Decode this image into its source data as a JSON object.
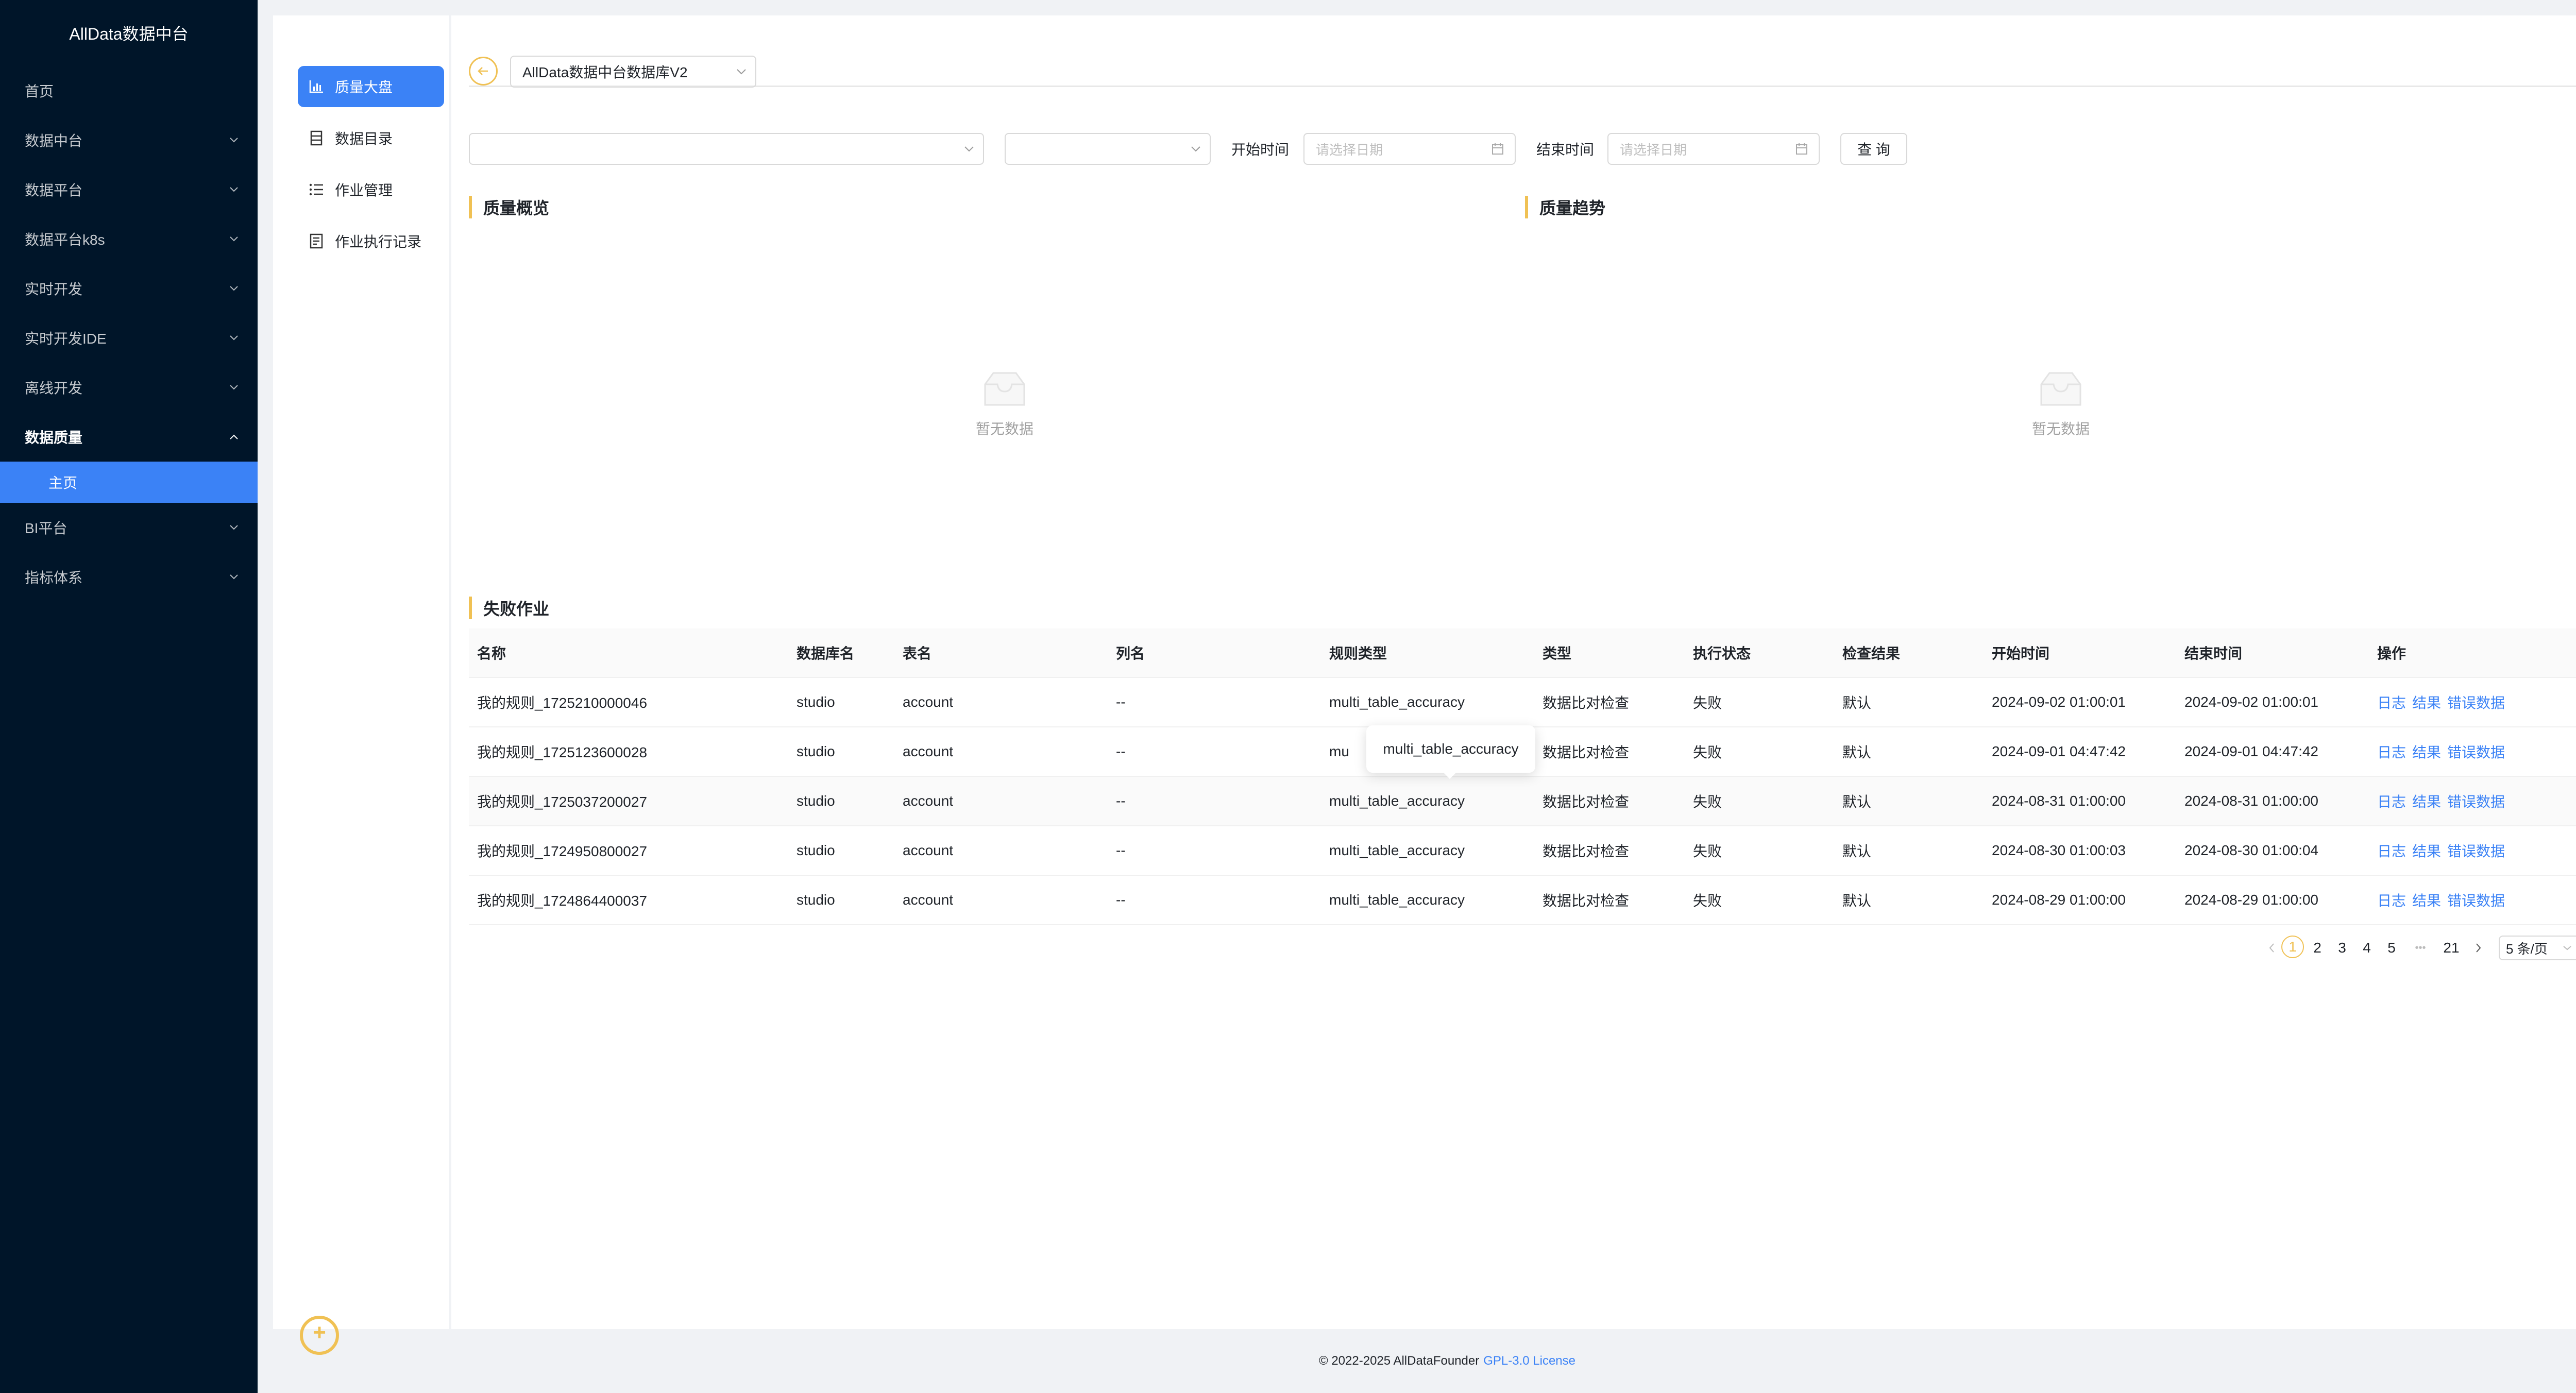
{
  "app": {
    "brand": "AllData数据中台"
  },
  "sidebar": {
    "items": [
      {
        "label": "首页",
        "chevron": false
      },
      {
        "label": "数据中台",
        "chevron": true
      },
      {
        "label": "数据平台",
        "chevron": true
      },
      {
        "label": "数据平台k8s",
        "chevron": true
      },
      {
        "label": "实时开发",
        "chevron": true
      },
      {
        "label": "实时开发IDE",
        "chevron": true
      },
      {
        "label": "离线开发",
        "chevron": true
      },
      {
        "label": "数据质量",
        "chevron": true,
        "expanded": true
      },
      {
        "label": "BI平台",
        "chevron": true
      },
      {
        "label": "指标体系",
        "chevron": true
      }
    ],
    "active_sub": "主页"
  },
  "subnav": {
    "items": [
      {
        "label": "质量大盘",
        "icon": "bar-chart-icon",
        "active": true
      },
      {
        "label": "数据目录",
        "icon": "catalog-icon",
        "active": false
      },
      {
        "label": "作业管理",
        "icon": "list-icon",
        "active": false
      },
      {
        "label": "作业执行记录",
        "icon": "record-icon",
        "active": false
      }
    ]
  },
  "header": {
    "db_select": "AllData数据中台数据库V2"
  },
  "filters": {
    "start_label": "开始时间",
    "end_label": "结束时间",
    "start_placeholder": "请选择日期",
    "end_placeholder": "请选择日期",
    "query_button": "查 询"
  },
  "sections": {
    "overview_title": "质量概览",
    "trend_title": "质量趋势",
    "empty_text": "暂无数据",
    "failed_title": "失败作业"
  },
  "table": {
    "columns": [
      "名称",
      "数据库名",
      "表名",
      "列名",
      "规则类型",
      "类型",
      "执行状态",
      "检查结果",
      "开始时间",
      "结束时间",
      "操作"
    ],
    "rows": [
      {
        "name": "我的规则_1725210000046",
        "db": "studio",
        "table": "account",
        "column": "--",
        "rule": "multi_table_accuracy",
        "type": "数据比对检查",
        "status": "失败",
        "result": "默认",
        "start": "2024-09-02 01:00:01",
        "end": "2024-09-02 01:00:01"
      },
      {
        "name": "我的规则_1725123600028",
        "db": "studio",
        "table": "account",
        "column": "--",
        "rule": "mu",
        "type": "数据比对检查",
        "status": "失败",
        "result": "默认",
        "start": "2024-09-01 04:47:42",
        "end": "2024-09-01 04:47:42"
      },
      {
        "name": "我的规则_1725037200027",
        "db": "studio",
        "table": "account",
        "column": "--",
        "rule": "multi_table_accuracy",
        "type": "数据比对检查",
        "status": "失败",
        "result": "默认",
        "start": "2024-08-31 01:00:00",
        "end": "2024-08-31 01:00:00"
      },
      {
        "name": "我的规则_1724950800027",
        "db": "studio",
        "table": "account",
        "column": "--",
        "rule": "multi_table_accuracy",
        "type": "数据比对检查",
        "status": "失败",
        "result": "默认",
        "start": "2024-08-30 01:00:03",
        "end": "2024-08-30 01:00:04"
      },
      {
        "name": "我的规则_1724864400037",
        "db": "studio",
        "table": "account",
        "column": "--",
        "rule": "multi_table_accuracy",
        "type": "数据比对检查",
        "status": "失败",
        "result": "默认",
        "start": "2024-08-29 01:00:00",
        "end": "2024-08-29 01:00:00"
      }
    ],
    "actions": [
      "日志",
      "结果",
      "错误数据"
    ],
    "tooltip": "multi_table_accuracy"
  },
  "pagination": {
    "pages": [
      "1",
      "2",
      "3",
      "4",
      "5"
    ],
    "ellipsis": "•••",
    "last": "21",
    "current": "1",
    "page_size": "5 条/页"
  },
  "footer": {
    "copyright": "© 2022-2025 AllDataFounder",
    "license": "GPL-3.0 License"
  },
  "colors": {
    "nav_bg": "#001529",
    "accent": "#3b82f6",
    "highlight": "#f0c154"
  }
}
